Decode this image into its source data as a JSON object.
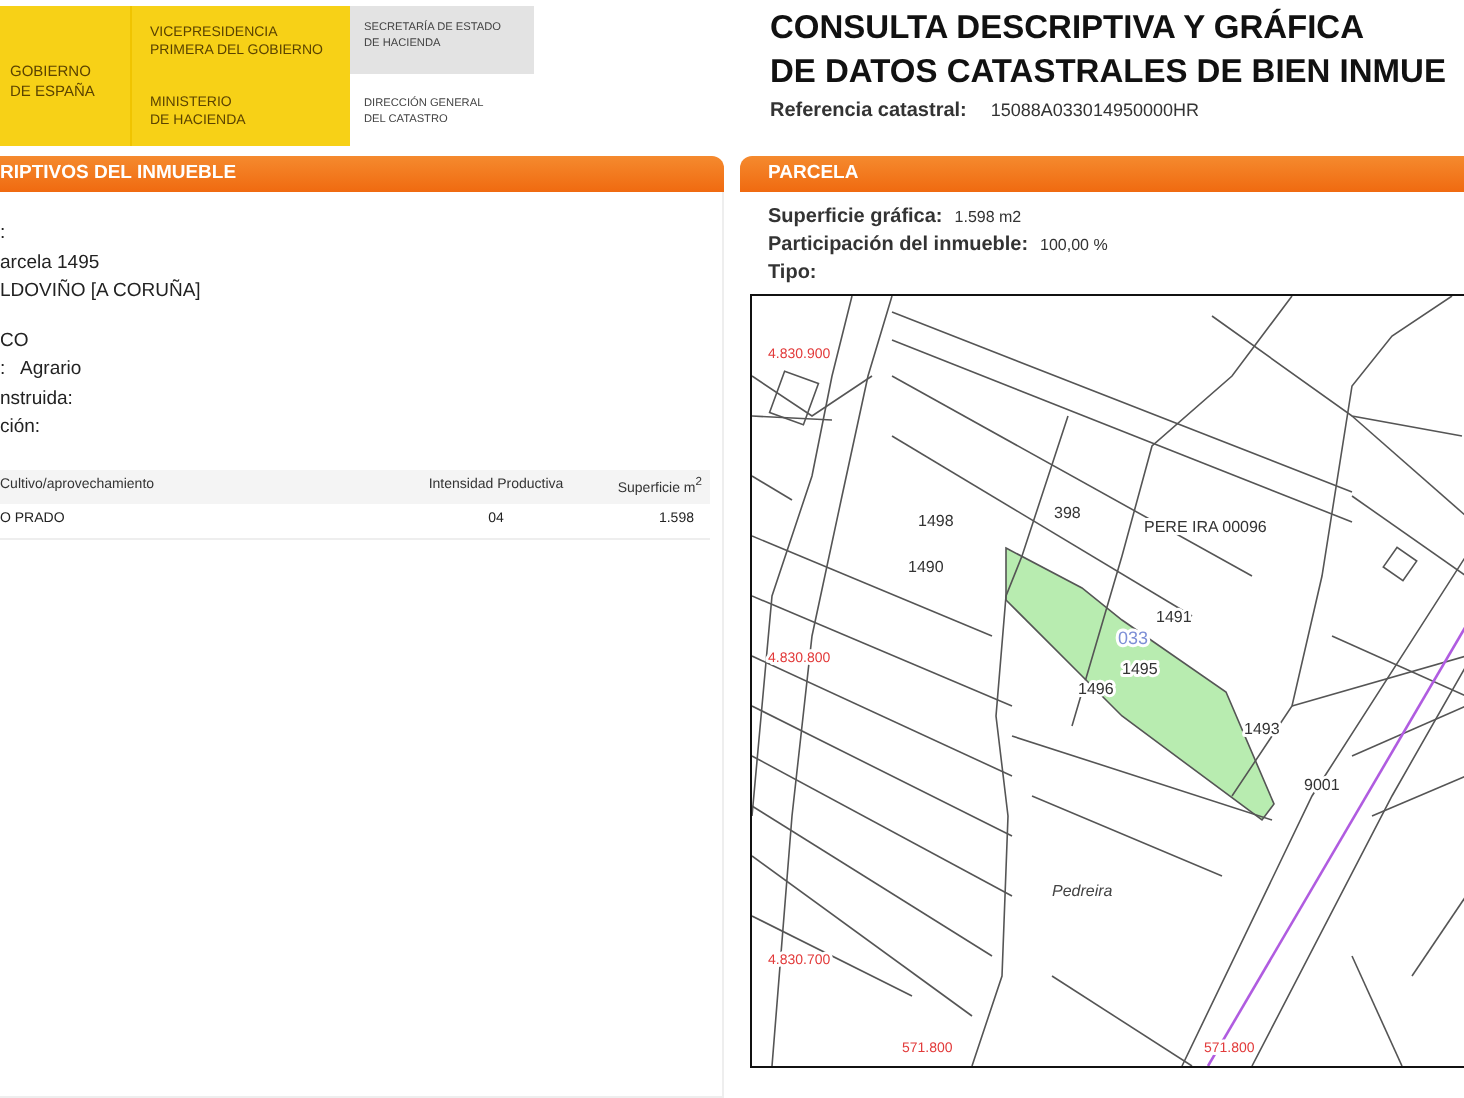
{
  "header": {
    "logo": {
      "government": "GOBIERNO\nDE ESPAÑA",
      "vicepresidency": "VICEPRESIDENCIA\nPRIMERA DEL GOBIERNO",
      "ministry": "MINISTERIO\nDE HACIENDA",
      "secretariat": "SECRETARÍA DE ESTADO\nDE HACIENDA",
      "directorate": "DIRECCIÓN GENERAL\nDEL CATASTRO"
    },
    "title": [
      "CONSULTA DESCRIPTIVA Y GRÁFICA",
      "DE DATOS CATASTRALES DE BIEN INMUE"
    ],
    "reference": {
      "label": "Referencia catastral:",
      "value": "15088A033014950000HR"
    }
  },
  "left_panel": {
    "title": "RIPTIVOS DEL INMUEBLE",
    "groups": [
      [
        ":",
        "arcela 1495",
        "LDOVIÑO [A CORUÑA]"
      ],
      [
        "CO",
        ":   Agrario",
        "nstruida:",
        "ción:"
      ]
    ],
    "table": {
      "columns": [
        "Cultivo/aprovechamiento",
        "Intensidad Productiva",
        "Superficie m$^{2}$"
      ],
      "rows": [
        [
          "O PRADO",
          "04",
          "1.598"
        ]
      ]
    }
  },
  "right_panel": {
    "title": "PARCELA",
    "fields": [
      {
        "label": "Superficie gráfica:",
        "value": "1.598 m2"
      },
      {
        "label": "Participación del inmueble:",
        "value": "100,00 %"
      },
      {
        "label": "Tipo:"
      }
    ],
    "map": {
      "labels": [
        {
          "text": "4.830.900",
          "kind": "coordinate"
        },
        {
          "text": "4.830.800",
          "kind": "coordinate"
        },
        {
          "text": "4.830.700",
          "kind": "coordinate"
        },
        {
          "text": "571.800",
          "kind": "coordinate"
        },
        {
          "text": "571.800",
          "kind": "coordinate"
        },
        {
          "text": "1498",
          "kind": "parcel"
        },
        {
          "text": "398",
          "kind": "parcel"
        },
        {
          "text": "PERE IRA 00096",
          "kind": "parcel"
        },
        {
          "text": "1490",
          "kind": "parcel"
        },
        {
          "text": "1491",
          "kind": "parcel"
        },
        {
          "text": "033",
          "kind": "subparcel"
        },
        {
          "text": "1495",
          "kind": "parcel"
        },
        {
          "text": "1496",
          "kind": "parcel"
        },
        {
          "text": "1493",
          "kind": "parcel"
        },
        {
          "text": "9001",
          "kind": "parcel"
        },
        {
          "text": "Pedreira",
          "kind": "place"
        }
      ]
    }
  }
}
